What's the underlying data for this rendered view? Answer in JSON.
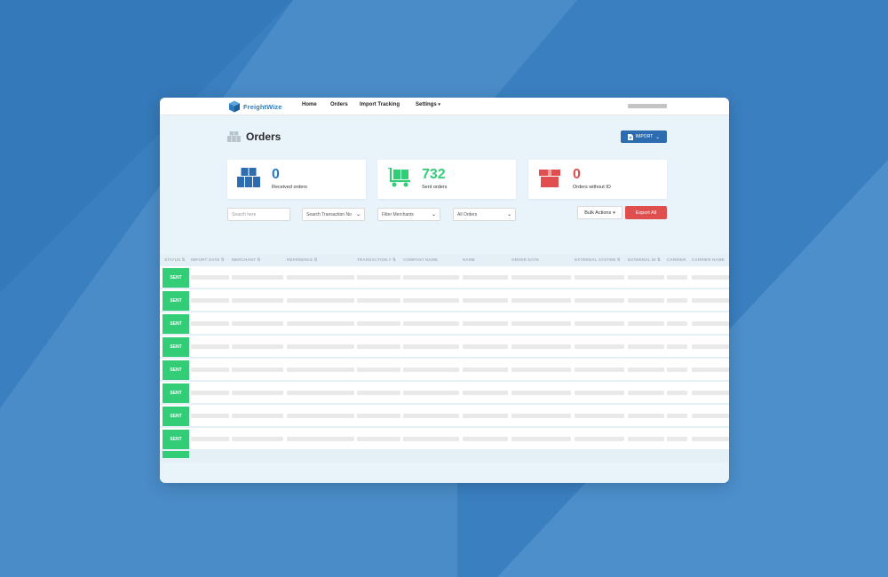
{
  "app": {
    "brand": "FreightWize",
    "brand_color": "#2d7bbd"
  },
  "nav": {
    "items": [
      {
        "label": "Home"
      },
      {
        "label": "Orders"
      },
      {
        "label": "Import Tracking"
      },
      {
        "label": "Settings",
        "has_dropdown": true
      }
    ]
  },
  "page": {
    "title": "Orders",
    "import_button": "IMPORT"
  },
  "stats": [
    {
      "value": "0",
      "label": "Received orders",
      "color": "#2d7bbd",
      "icon": "boxes-icon"
    },
    {
      "value": "732",
      "label": "Sent orders",
      "color": "#33cc77",
      "icon": "cart-icon"
    },
    {
      "value": "0",
      "label": "Orders without ID",
      "color": "#e04e4e",
      "icon": "box-icon"
    }
  ],
  "filters": {
    "search_placeholder": "Search here",
    "transaction": "Search Transaction No",
    "merchants": "Filter Merchants",
    "orders": "All Orders",
    "bulk_actions": "Bulk Actions",
    "export": "Export All"
  },
  "table": {
    "columns": [
      "STATUS ⇅",
      "IMPORT DATE ⇅",
      "MERCHANT ⇅",
      "REFERENCE ⇅",
      "TRANSACTION # ⇅",
      "COMPANY NAME",
      "NAME",
      "ORDER DATE",
      "EXTERNAL SYSTEM ⇅",
      "EXTERNAL ID ⇅",
      "CARRIER",
      "CARRIER NAME"
    ],
    "rows": [
      "SENT",
      "SENT",
      "SENT",
      "SENT",
      "SENT",
      "SENT",
      "SENT",
      "SENT"
    ]
  },
  "colors": {
    "accent": "#2d6cae",
    "success": "#33cc77",
    "danger": "#e04e4e",
    "background": "#3a7fc0"
  }
}
